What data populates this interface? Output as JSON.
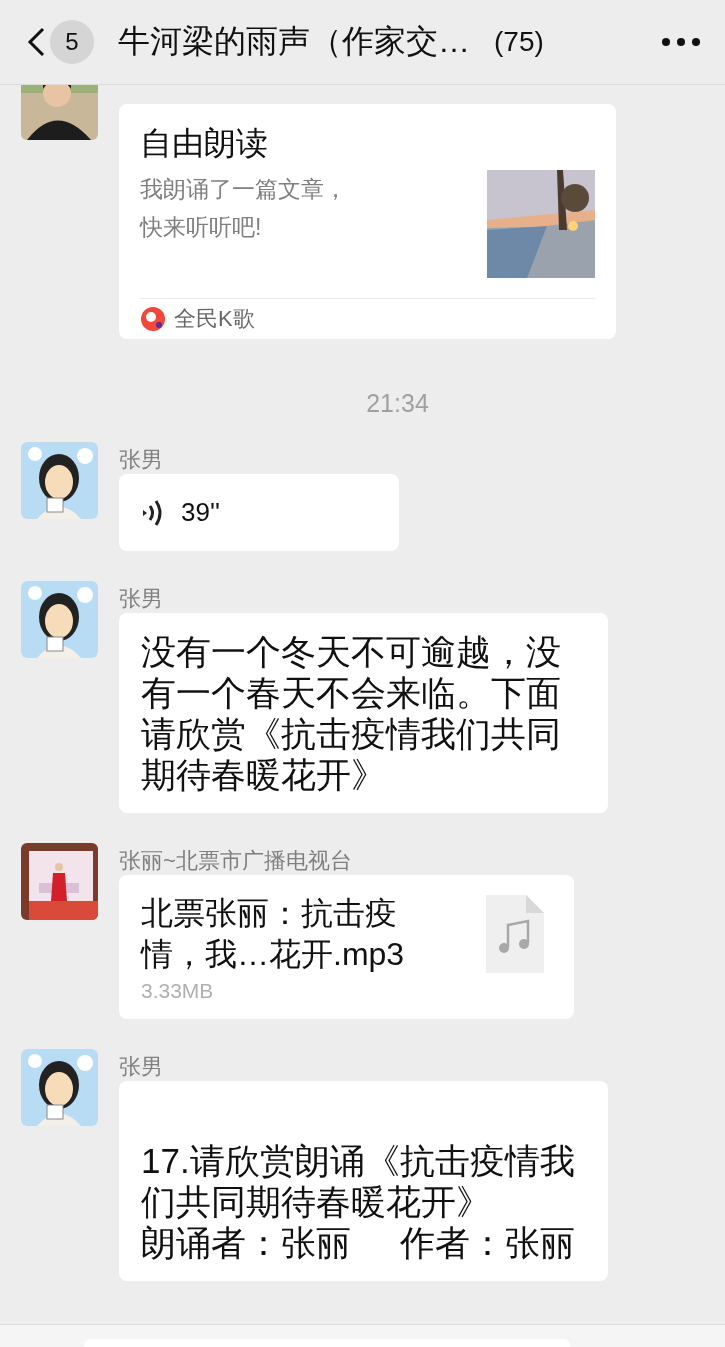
{
  "header": {
    "back_badge": "5",
    "title": "牛河梁的雨声（作家交…",
    "member_count": "(75)"
  },
  "messages": [
    {
      "kind": "link",
      "avatar": {
        "kind": "photo_woman"
      },
      "title": "自由朗读",
      "description": "我朗诵了一篇文章，快来听听吧!",
      "source": "全民K歌"
    },
    {
      "kind": "time",
      "text": "21:34"
    },
    {
      "kind": "voice",
      "avatar": {
        "kind": "cartoon"
      },
      "sender": "张男",
      "duration": "39''"
    },
    {
      "kind": "text",
      "avatar": {
        "kind": "cartoon"
      },
      "sender": "张男",
      "blank_first_line": false,
      "paragraphs": [
        "没有一个冬天不可逾越，没有一个春天不会来临。下面请欣赏《抗击疫情我们共同期待春暖花开》"
      ]
    },
    {
      "kind": "file",
      "avatar": {
        "kind": "photo_stage"
      },
      "sender": "张丽~北票市广播电视台",
      "file_name": "北票张丽：抗击疫情，我…花开.mp3",
      "size": "3.33MB"
    },
    {
      "kind": "text",
      "avatar": {
        "kind": "cartoon"
      },
      "sender": "张男",
      "blank_first_line": true,
      "paragraphs": [
        "17.请欣赏朗诵《抗击疫情我们共同期待春暖花开》",
        "朗诵者：张丽     作者：张丽"
      ]
    }
  ]
}
